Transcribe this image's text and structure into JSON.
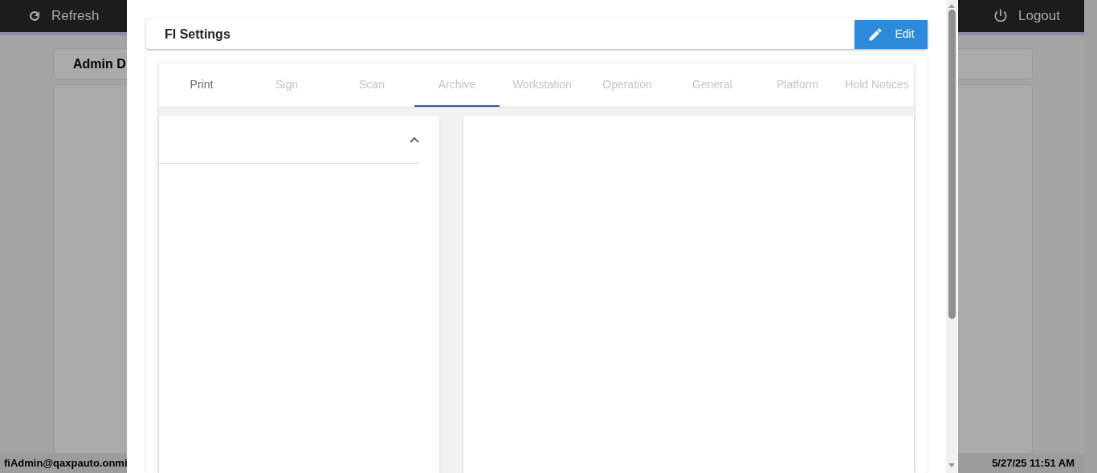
{
  "topbar": {
    "refresh_button": "Refresh",
    "logout_button": "Logout"
  },
  "background": {
    "card_title": "Admin D"
  },
  "footer": {
    "user": "fiAdmin@qaxpauto.onmi",
    "datetime": "5/27/25 11:51 AM"
  },
  "modal": {
    "title": "FI Settings",
    "edit_button": "Edit",
    "tabs": [
      {
        "label": "Print",
        "selected": false,
        "disabled": false
      },
      {
        "label": "Sign",
        "selected": false,
        "disabled": true
      },
      {
        "label": "Scan",
        "selected": false,
        "disabled": true
      },
      {
        "label": "Archive",
        "selected": true,
        "disabled": true
      },
      {
        "label": "Workstation",
        "selected": false,
        "disabled": true
      },
      {
        "label": "Operation",
        "selected": false,
        "disabled": true
      },
      {
        "label": "General",
        "selected": false,
        "disabled": true
      },
      {
        "label": "Platform",
        "selected": false,
        "disabled": true
      },
      {
        "label": "Hold Notices",
        "selected": false,
        "disabled": true
      }
    ],
    "left_panel": {
      "expanded": true
    }
  }
}
